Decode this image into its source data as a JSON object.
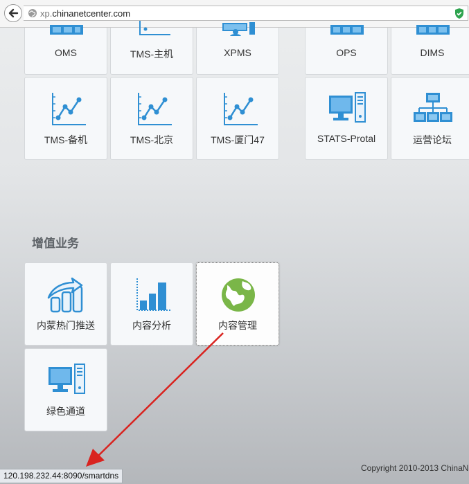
{
  "browser": {
    "url_prefix": "xp.",
    "url_domain": "chinanetcenter.com"
  },
  "top_row": [
    {
      "label": "OMS",
      "icon": "server-icon"
    },
    {
      "label": "TMS-主机",
      "icon": "line-chart-icon"
    },
    {
      "label": "XPMS",
      "icon": "computer-user-icon"
    },
    {
      "label": "OPS",
      "icon": "server-icon"
    },
    {
      "label": "DIMS",
      "icon": "server-icon"
    }
  ],
  "second_row": [
    {
      "label": "TMS-备机",
      "icon": "line-chart-icon"
    },
    {
      "label": "TMS-北京",
      "icon": "line-chart-icon"
    },
    {
      "label": "TMS-厦门47",
      "icon": "line-chart-icon"
    },
    {
      "label": "STATS-Protal",
      "icon": "computer-icon"
    },
    {
      "label": "运营论坛",
      "icon": "network-icon"
    }
  ],
  "value_added": {
    "title": "增值业务",
    "tiles": [
      {
        "label": "内蒙热门推送",
        "icon": "trending-bar-arrow-icon"
      },
      {
        "label": "内容分析",
        "icon": "bar-chart-icon"
      },
      {
        "label": "内容管理",
        "icon": "green-globe-icon"
      },
      {
        "label": "绿色通道",
        "icon": "computer-icon"
      }
    ]
  },
  "footer": {
    "copyright": "Copyright 2010-2013 ChinaN"
  },
  "status_bar": {
    "link_url": "120.198.232.44:8090/smartdns"
  },
  "colors": {
    "icon_blue": "#2f8fd3",
    "globe_green": "#7ab648",
    "arrow_red": "#d9231f"
  }
}
